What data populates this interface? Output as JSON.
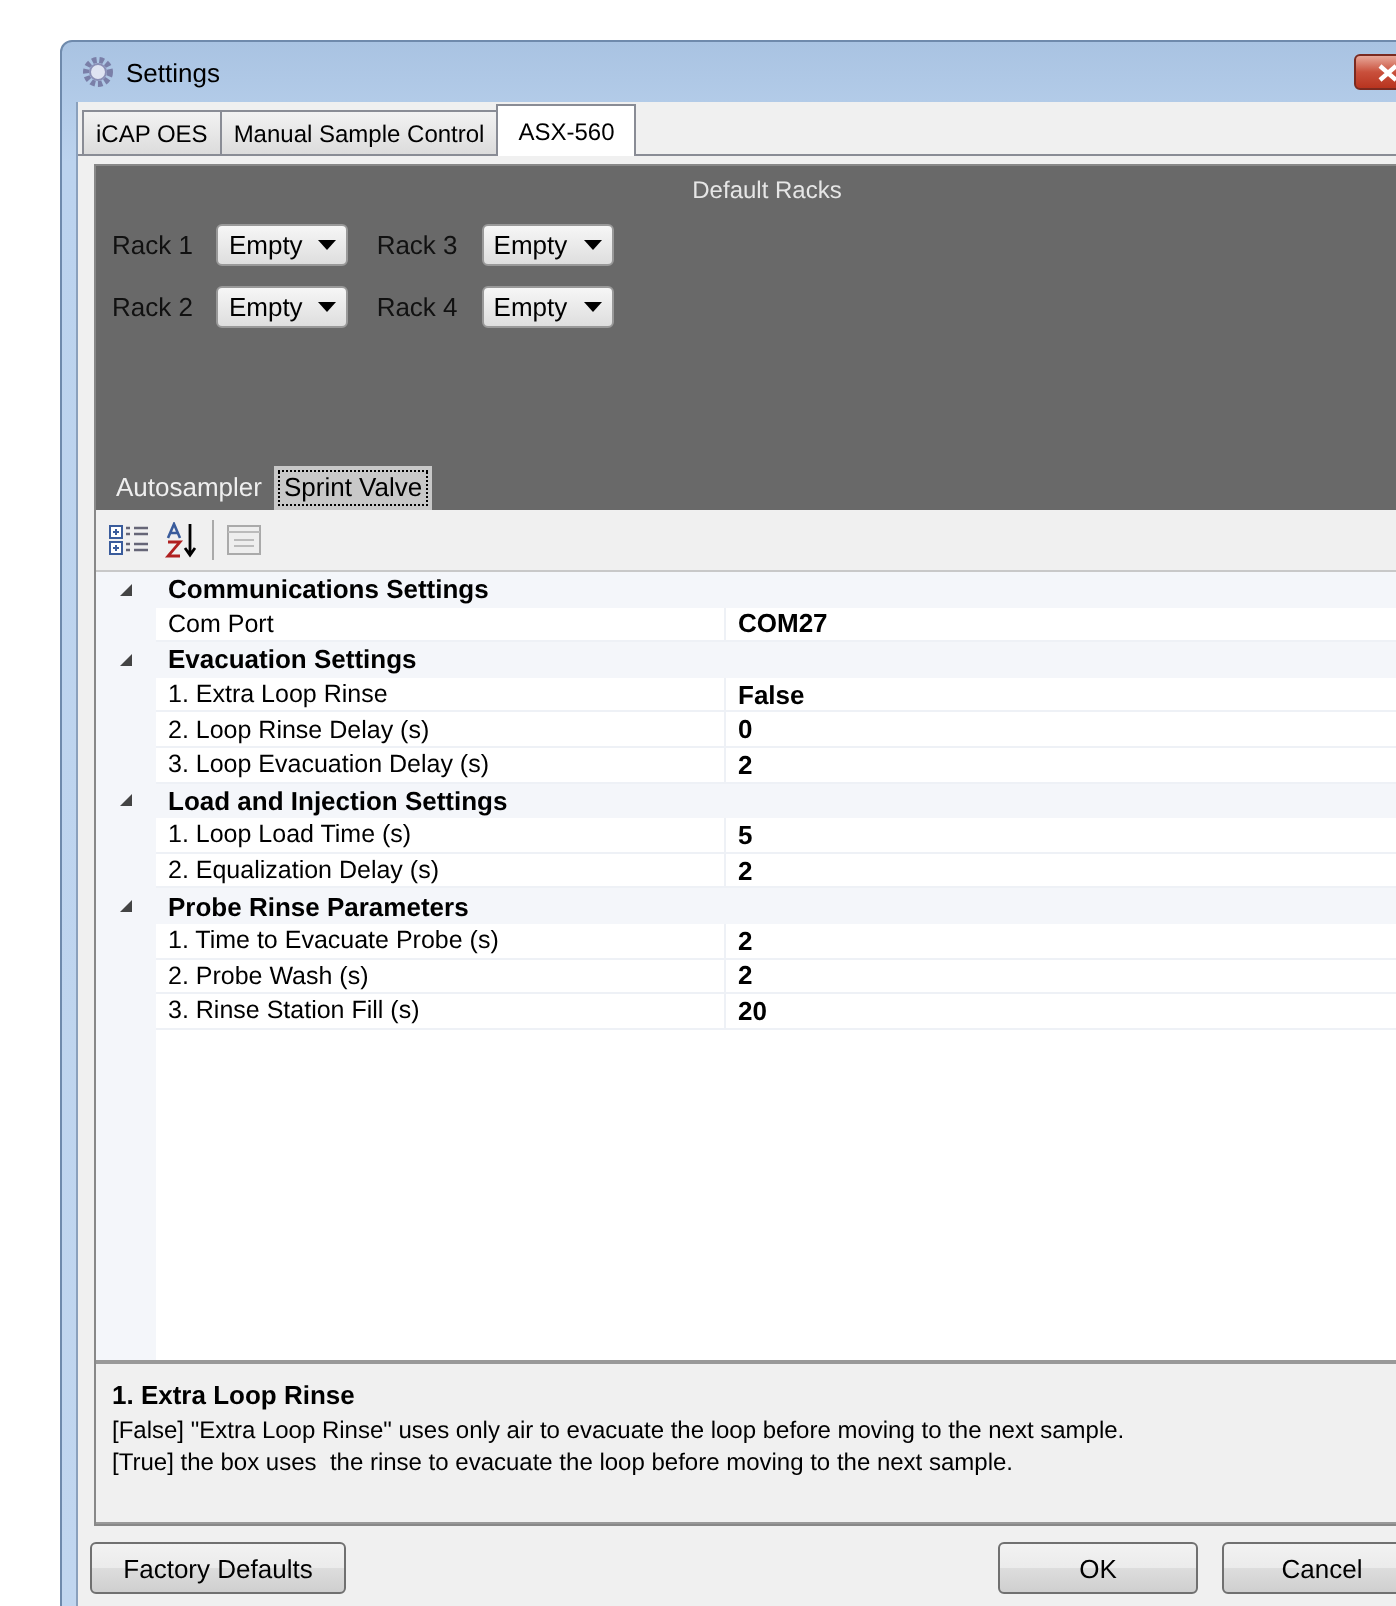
{
  "window": {
    "title": "Settings"
  },
  "tabs": [
    {
      "label": "iCAP OES",
      "selected": false
    },
    {
      "label": "Manual Sample Control",
      "selected": false
    },
    {
      "label": "ASX-560",
      "selected": true
    }
  ],
  "default_racks": {
    "title": "Default Racks",
    "racks": [
      {
        "label": "Rack 1",
        "value": "Empty"
      },
      {
        "label": "Rack 3",
        "value": "Empty"
      },
      {
        "label": "Rack 2",
        "value": "Empty"
      },
      {
        "label": "Rack 4",
        "value": "Empty"
      }
    ]
  },
  "subtabs": [
    {
      "label": "Autosampler",
      "selected": false
    },
    {
      "label": "Sprint Valve",
      "selected": true
    }
  ],
  "property_grid": {
    "categories": [
      {
        "name": "Communications Settings",
        "expanded": true,
        "properties": [
          {
            "name": "Com Port",
            "value": "COM27"
          }
        ]
      },
      {
        "name": "Evacuation Settings",
        "expanded": true,
        "properties": [
          {
            "name": "1. Extra Loop Rinse",
            "value": "False"
          },
          {
            "name": "2. Loop Rinse Delay (s)",
            "value": "0"
          },
          {
            "name": "3. Loop Evacuation Delay (s)",
            "value": "2"
          }
        ]
      },
      {
        "name": "Load and Injection Settings",
        "expanded": true,
        "properties": [
          {
            "name": "1. Loop Load Time (s)",
            "value": "5"
          },
          {
            "name": "2. Equalization Delay (s)",
            "value": "2"
          }
        ]
      },
      {
        "name": "Probe Rinse Parameters",
        "expanded": true,
        "properties": [
          {
            "name": "1. Time to Evacuate Probe (s)",
            "value": "2"
          },
          {
            "name": "2. Probe Wash (s)",
            "value": "2"
          },
          {
            "name": "3. Rinse Station Fill (s)",
            "value": "20"
          }
        ]
      }
    ]
  },
  "description": {
    "title": "1. Extra Loop Rinse",
    "lines": [
      "[False] \"Extra Loop Rinse\" uses only air to evacuate the loop before moving to the next sample.",
      "[True] the box uses  the rinse to evacuate the loop before moving to the next sample."
    ]
  },
  "buttons": {
    "left": [
      "Factory Defaults"
    ],
    "right": [
      "OK",
      "Cancel"
    ]
  }
}
